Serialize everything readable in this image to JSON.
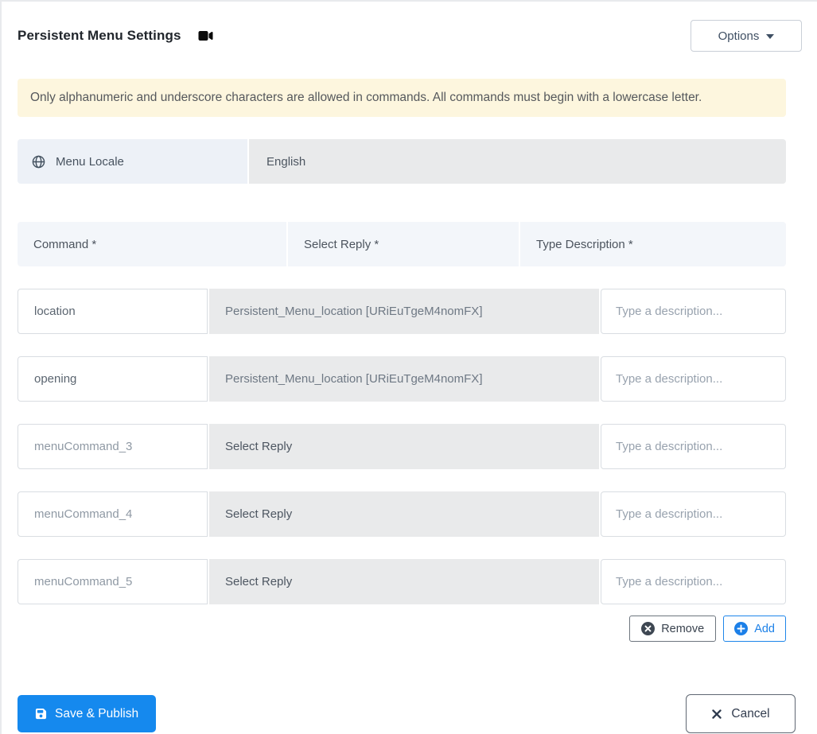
{
  "header": {
    "title": "Persistent Menu Settings",
    "options_button": "Options"
  },
  "alert": {
    "message": "Only alphanumeric and underscore characters are allowed in commands. All commands must begin with a lowercase letter."
  },
  "locale": {
    "label": "Menu Locale",
    "value": "English"
  },
  "table": {
    "headers": {
      "command": "Command *",
      "reply": "Select Reply *",
      "description": "Type Description *"
    },
    "description_placeholder": "Type a description...",
    "rows": [
      {
        "command": "location",
        "reply": "Persistent_Menu_location [URiEuTgeM4nomFX]",
        "reply_is_selected": true
      },
      {
        "command": "opening",
        "reply": "Persistent_Menu_location [URiEuTgeM4nomFX]",
        "reply_is_selected": true
      },
      {
        "command_placeholder": "menuCommand_3",
        "reply": "Select Reply",
        "reply_is_selected": false
      },
      {
        "command_placeholder": "menuCommand_4",
        "reply": "Select Reply",
        "reply_is_selected": false
      },
      {
        "command_placeholder": "menuCommand_5",
        "reply": "Select Reply",
        "reply_is_selected": false
      }
    ]
  },
  "actions": {
    "remove": "Remove",
    "add": "Add"
  },
  "footer": {
    "save": "Save & Publish",
    "cancel": "Cancel"
  },
  "colors": {
    "primary_blue": "#1589ee",
    "add_blue": "#1b80e8",
    "alert_bg": "#fdf6de",
    "table_header_bg": "#f3f6fa",
    "select_bg": "#e9eaeb",
    "locale_label_bg": "#edf1f7",
    "remove_icon": "#3e4752",
    "title_text": "#21262c"
  }
}
